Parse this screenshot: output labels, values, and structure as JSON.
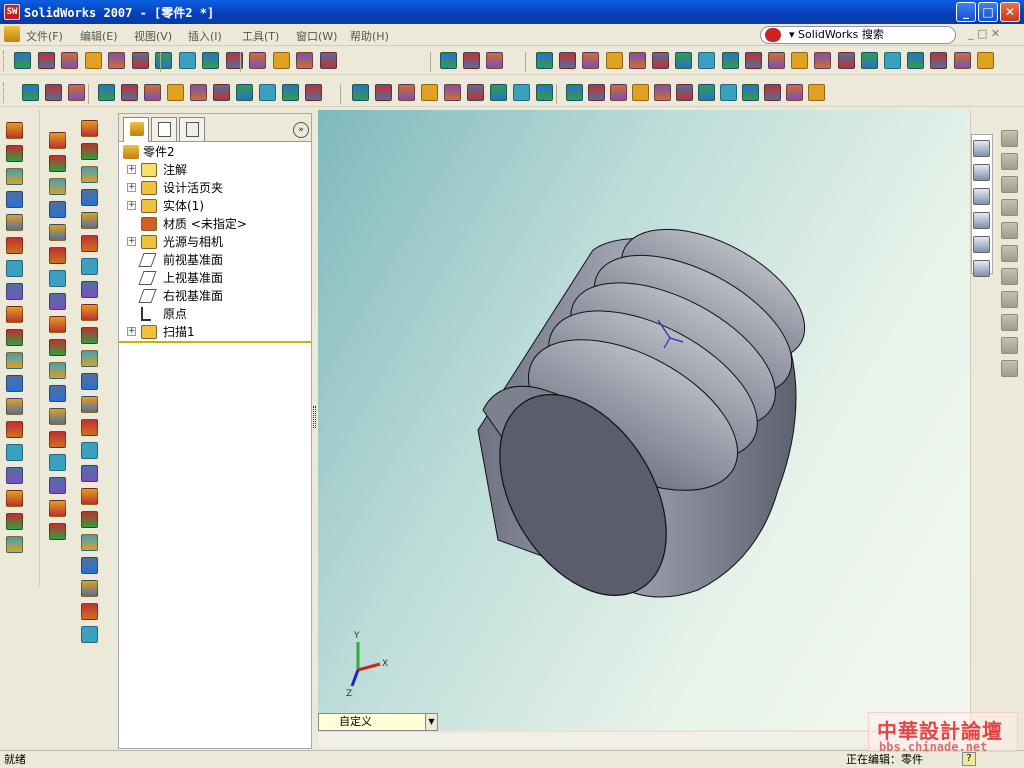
{
  "window": {
    "title": "SolidWorks 2007 - [零件2 *]",
    "app_icon": "SW",
    "min_label": "_",
    "max_label": "□",
    "close_label": "✕"
  },
  "menu": {
    "items": [
      "文件(F)",
      "编辑(E)",
      "视图(V)",
      "插入(I)",
      "工具(T)",
      "窗口(W)",
      "帮助(H)"
    ],
    "search_placeholder": "▾ SolidWorks 搜索",
    "mdi_controls": "_ □ ✕"
  },
  "tree": {
    "collapse_label": "»",
    "root": "零件2",
    "nodes": [
      {
        "label": "注解",
        "expandable": true,
        "icon": "annotation-icon"
      },
      {
        "label": "设计活页夹",
        "expandable": true,
        "icon": "design-binder-icon"
      },
      {
        "label": "实体(1)",
        "expandable": true,
        "icon": "solid-bodies-icon"
      },
      {
        "label": "材质 <未指定>",
        "expandable": false,
        "icon": "material-icon"
      },
      {
        "label": "光源与相机",
        "expandable": true,
        "icon": "lights-cameras-icon"
      },
      {
        "label": "前视基准面",
        "expandable": false,
        "icon": "plane-icon"
      },
      {
        "label": "上视基准面",
        "expandable": false,
        "icon": "plane-icon"
      },
      {
        "label": "右视基准面",
        "expandable": false,
        "icon": "plane-icon"
      },
      {
        "label": "原点",
        "expandable": false,
        "icon": "origin-icon"
      },
      {
        "label": "扫描1",
        "expandable": true,
        "icon": "sweep-feature-icon"
      }
    ]
  },
  "viewport": {
    "view_orientation": "自定义",
    "triad": {
      "x": "X",
      "y": "Y",
      "z": "Z"
    }
  },
  "status": {
    "left": "就绪",
    "right": "正在编辑：零件",
    "help": "?"
  },
  "watermark": {
    "line1": "中華設計論壇",
    "line2": "bbs.chinade.net"
  },
  "colors": {
    "title_bar": "#0a4fd0",
    "model_gray": "#8c8f9c",
    "viewport_top": "#7fb8bd",
    "viewport_bottom": "#f3f8f0",
    "tree_end_bar": "#c8b400"
  }
}
